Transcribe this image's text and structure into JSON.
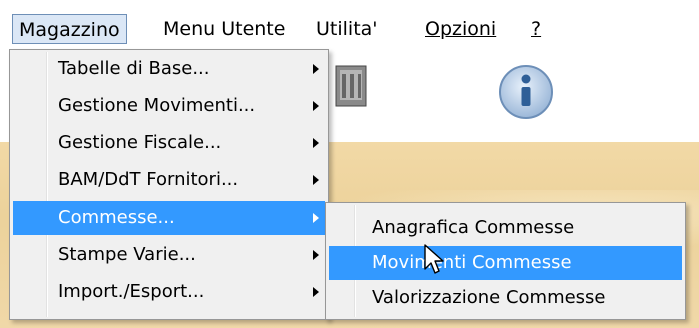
{
  "menubar": {
    "items": [
      {
        "label": "Magazzino"
      },
      {
        "label": "Menu Utente"
      },
      {
        "label": "Utilita'"
      },
      {
        "label": "Opzioni"
      },
      {
        "label": "?"
      }
    ]
  },
  "dropdown": {
    "items": [
      {
        "label": "Tabelle di Base..."
      },
      {
        "label": "Gestione Movimenti..."
      },
      {
        "label": "Gestione Fiscale..."
      },
      {
        "label": "BAM/DdT Fornitori..."
      },
      {
        "label": "Commesse..."
      },
      {
        "label": "Stampe Varie..."
      },
      {
        "label": "Import./Esport..."
      }
    ]
  },
  "submenu": {
    "items": [
      {
        "label": "Anagrafica Commesse"
      },
      {
        "label": "Movimenti Commesse"
      },
      {
        "label": "Valorizzazione Commesse"
      }
    ]
  },
  "colors": {
    "highlight": "#3399ff",
    "menu_bg": "#f0f0f0",
    "active_menubar_bg": "#dbe7f6"
  },
  "icons": {
    "toolbar_left": "printer-icon",
    "toolbar_right": "info-icon",
    "pointer": "mouse-pointer-icon"
  }
}
